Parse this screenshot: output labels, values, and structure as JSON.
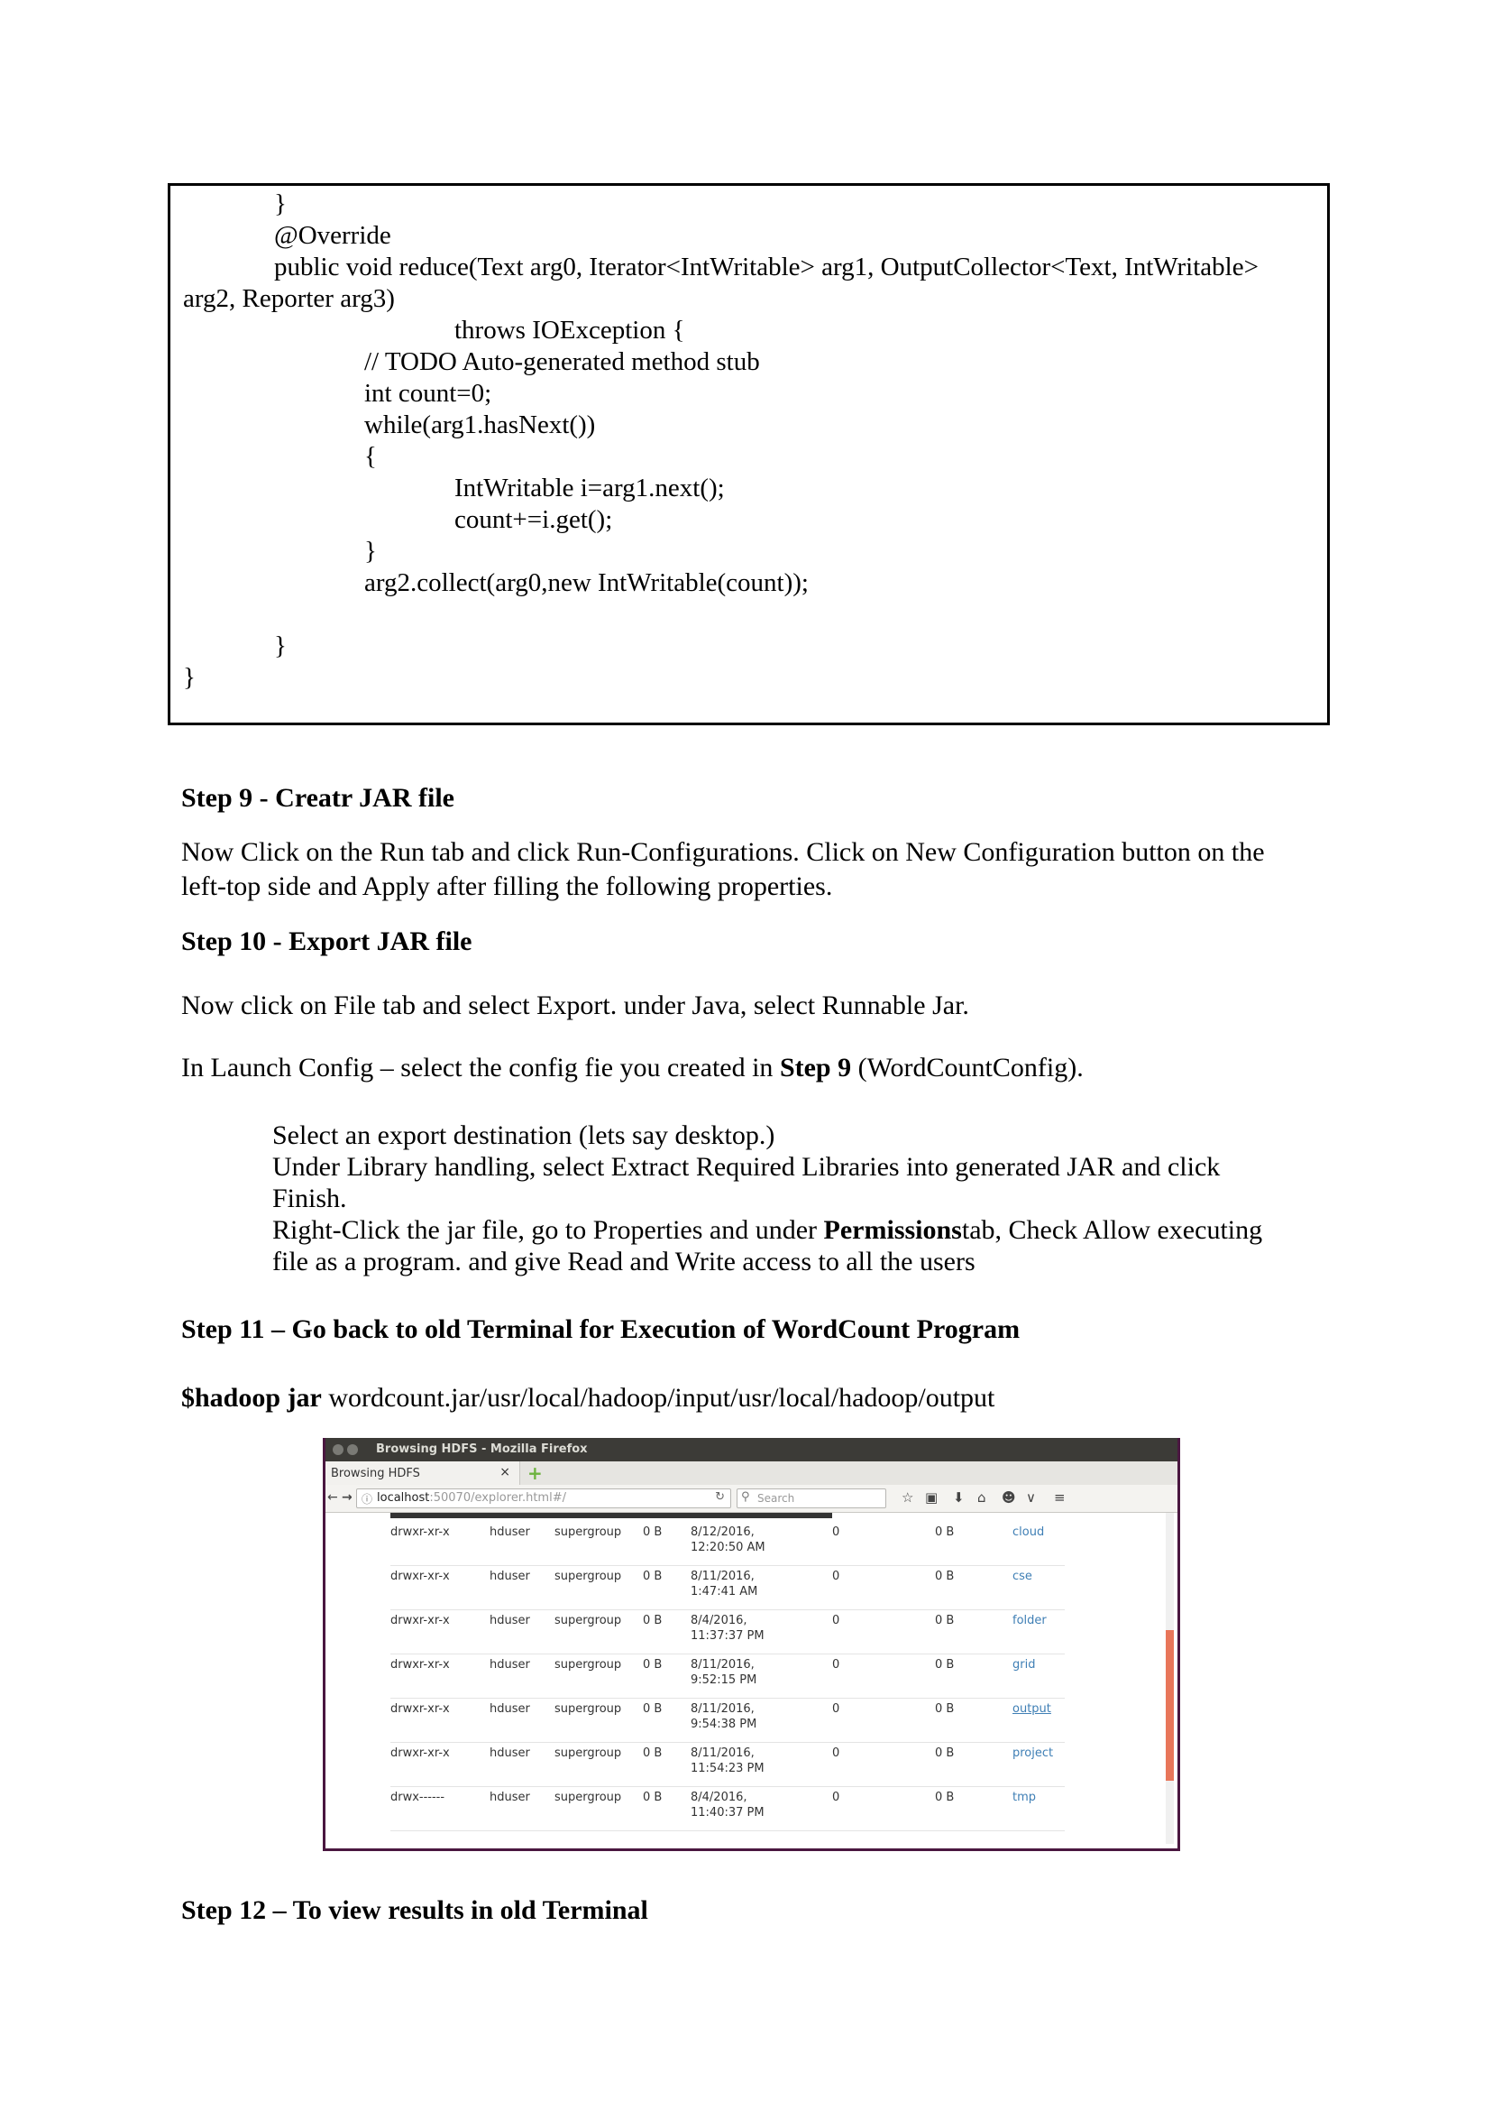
{
  "code": {
    "lines": [
      "}",
      "@Override",
      "public void reduce(Text arg0, Iterator<IntWritable> arg1, OutputCollector<Text, IntWritable>",
      "arg2, Reporter arg3)",
      "throws IOException {",
      "// TODO Auto-generated method stub",
      "int count=0;",
      "while(arg1.hasNext())",
      "{",
      "IntWritable i=arg1.next();",
      "count+=i.get();",
      "}",
      "arg2.collect(arg0,new IntWritable(count));",
      "}",
      "}"
    ]
  },
  "step9": {
    "heading": "Step 9 - Creatr JAR file",
    "line1": "Now Click on the Run tab and click Run-Configurations. Click on New Configuration button on the",
    "line2": "left-top side and Apply after filling the following properties."
  },
  "step10": {
    "heading": "Step 10 - Export JAR file",
    "line1": " Now click on File tab and select Export. under Java, select Runnable Jar.",
    "launch_pre": "In Launch Config – select the config fie you created in ",
    "launch_bold": "Step 9",
    "launch_post": "  (WordCountConfig).",
    "bullet1": "Select an export destination (lets say desktop.)",
    "bullet2a": "Under Library handling, select Extract Required Libraries into generated JAR and click",
    "bullet2b": "Finish.",
    "bullet3_pre": "Right-Click the jar file, go to Properties and under ",
    "bullet3_bold": "Permissions",
    "bullet3_post": "tab, Check Allow executing",
    "bullet3b": "file as a program. and give Read and Write access to all the users"
  },
  "step11": {
    "heading": "Step 11 – Go back to old Terminal for Execution of WordCount Program",
    "cmd_bold": "$hadoop jar",
    "cmd_rest": " wordcount.jar/usr/local/hadoop/input/usr/local/hadoop/output"
  },
  "browser": {
    "window_title": "Browsing HDFS - Mozilla Firefox",
    "tab_label": "Browsing HDFS",
    "tab_close": "×",
    "new_tab": "+",
    "url_host": "localhost",
    "url_rest": ":50070/explorer.html#/",
    "search_placeholder": "Search",
    "rows": [
      {
        "perm": "drwxr-xr-x",
        "owner": "hduser",
        "group": "supergroup",
        "size": "0 B",
        "date": "8/12/2016,",
        "time": "12:20:50 AM",
        "repl": "0",
        "block": "0 B",
        "name": "cloud"
      },
      {
        "perm": "drwxr-xr-x",
        "owner": "hduser",
        "group": "supergroup",
        "size": "0 B",
        "date": "8/11/2016,",
        "time": "1:47:41 AM",
        "repl": "0",
        "block": "0 B",
        "name": "cse"
      },
      {
        "perm": "drwxr-xr-x",
        "owner": "hduser",
        "group": "supergroup",
        "size": "0 B",
        "date": "8/4/2016,",
        "time": "11:37:37 PM",
        "repl": "0",
        "block": "0 B",
        "name": "folder"
      },
      {
        "perm": "drwxr-xr-x",
        "owner": "hduser",
        "group": "supergroup",
        "size": "0 B",
        "date": "8/11/2016,",
        "time": "9:52:15 PM",
        "repl": "0",
        "block": "0 B",
        "name": "grid"
      },
      {
        "perm": "drwxr-xr-x",
        "owner": "hduser",
        "group": "supergroup",
        "size": "0 B",
        "date": "8/11/2016,",
        "time": "9:54:38 PM",
        "repl": "0",
        "block": "0 B",
        "name": "output"
      },
      {
        "perm": "drwxr-xr-x",
        "owner": "hduser",
        "group": "supergroup",
        "size": "0 B",
        "date": "8/11/2016,",
        "time": "11:54:23 PM",
        "repl": "0",
        "block": "0 B",
        "name": "project"
      },
      {
        "perm": "drwx------",
        "owner": "hduser",
        "group": "supergroup",
        "size": "0 B",
        "date": "8/4/2016,",
        "time": "11:40:37 PM",
        "repl": "0",
        "block": "0 B",
        "name": "tmp"
      }
    ]
  },
  "step12": {
    "heading": "Step 12 – To view results in old Terminal"
  },
  "colors": {
    "link": "#3f7fb5",
    "titlebar": "#3c3b37",
    "scroll_thumb": "#e8765a",
    "window_border": "#4a1740"
  }
}
